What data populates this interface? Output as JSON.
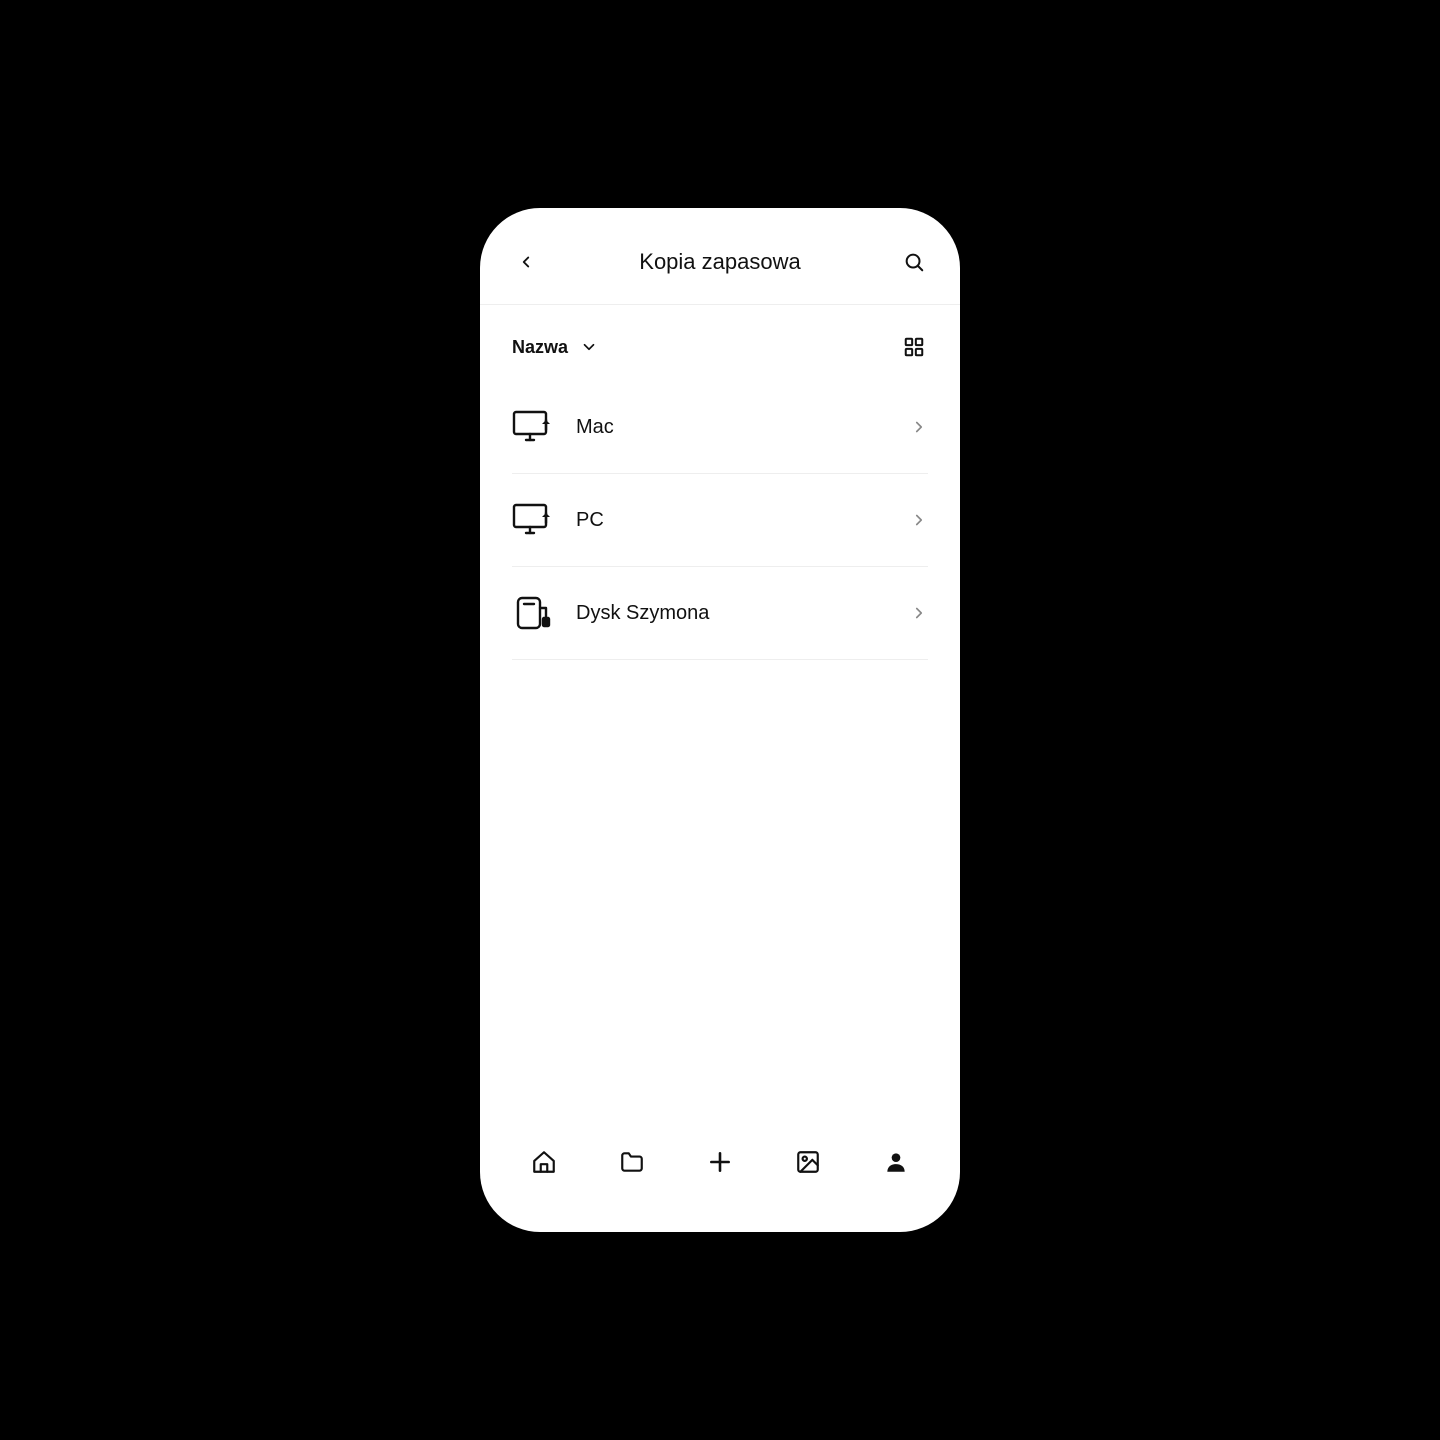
{
  "header": {
    "title": "Kopia zapasowa"
  },
  "sort": {
    "label": "Nazwa"
  },
  "items": [
    {
      "label": "Mac",
      "icon": "computer-upload"
    },
    {
      "label": "PC",
      "icon": "computer-upload"
    },
    {
      "label": "Dysk Szymona",
      "icon": "external-drive"
    }
  ]
}
